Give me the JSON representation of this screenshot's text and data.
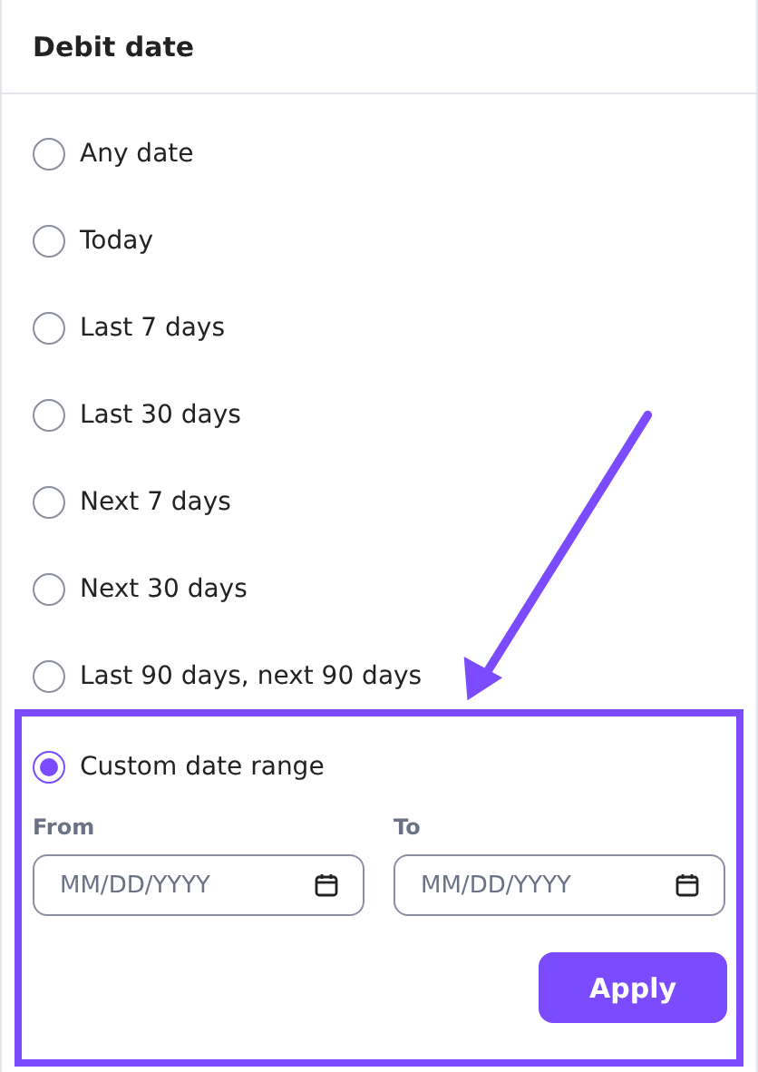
{
  "title": "Debit date",
  "options": [
    {
      "label": "Any date",
      "selected": false
    },
    {
      "label": "Today",
      "selected": false
    },
    {
      "label": "Last 7 days",
      "selected": false
    },
    {
      "label": "Last 30 days",
      "selected": false
    },
    {
      "label": "Next 7 days",
      "selected": false
    },
    {
      "label": "Next 30 days",
      "selected": false
    },
    {
      "label": "Last 90 days, next 90 days",
      "selected": false
    }
  ],
  "custom_range": {
    "option": {
      "label": "Custom date range",
      "selected": true
    },
    "fields": [
      {
        "label": "From",
        "placeholder": "MM/DD/YYYY"
      },
      {
        "label": "To",
        "placeholder": "MM/DD/YYYY"
      }
    ],
    "button": "Apply"
  }
}
